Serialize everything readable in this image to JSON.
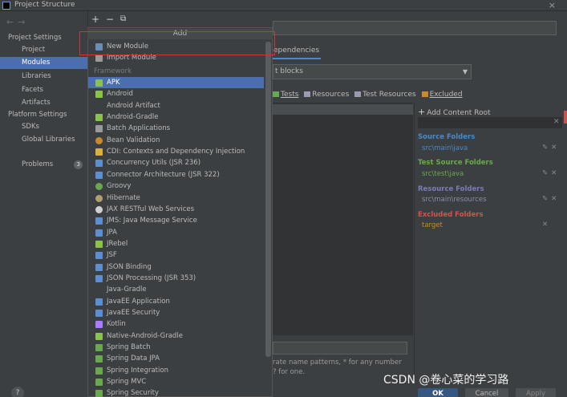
{
  "window": {
    "title": "Project Structure",
    "close": "×"
  },
  "toolbar": {
    "add": "+",
    "remove": "−",
    "copy": "⧉"
  },
  "nav": {
    "back": "←",
    "forward": "→"
  },
  "sidebar": {
    "group_project_settings": "Project Settings",
    "items_project": [
      {
        "label": "Project"
      },
      {
        "label": "Modules",
        "selected": true
      },
      {
        "label": "Libraries"
      },
      {
        "label": "Facets"
      },
      {
        "label": "Artifacts"
      }
    ],
    "group_platform_settings": "Platform Settings",
    "items_platform": [
      {
        "label": "SDKs"
      },
      {
        "label": "Global Libraries"
      }
    ],
    "problems": {
      "label": "Problems",
      "count": "3"
    },
    "help": "?"
  },
  "popup": {
    "header": "Add",
    "top_items": [
      {
        "label": "New Module",
        "icon": "module-icon",
        "color": "#6a8eb8"
      },
      {
        "label": "Import Module",
        "icon": "import-icon",
        "color": "#9a9a9a"
      }
    ],
    "section_label": "Framework",
    "framework_items": [
      {
        "label": "APK",
        "icon": "android-icon",
        "color": "#8bc34a",
        "selected": true
      },
      {
        "label": "Android",
        "icon": "android-icon",
        "color": "#8bc34a"
      },
      {
        "label": "Android Artifact",
        "icon": "",
        "color": ""
      },
      {
        "label": "Android-Gradle",
        "icon": "android-icon",
        "color": "#8bc34a"
      },
      {
        "label": "Batch Applications",
        "icon": "batch-icon",
        "color": "#9a9a9a"
      },
      {
        "label": "Bean Validation",
        "icon": "bean-icon",
        "color": "#c98a2b"
      },
      {
        "label": "CDI: Contexts and Dependency Injection",
        "icon": "cdi-icon",
        "color": "#d9b23a"
      },
      {
        "label": "Concurrency Utils (JSR 236)",
        "icon": "jee-icon",
        "color": "#5b8fd1"
      },
      {
        "label": "Connector Architecture (JSR 322)",
        "icon": "jee-icon",
        "color": "#5b8fd1"
      },
      {
        "label": "Groovy",
        "icon": "groovy-icon",
        "color": "#6aa84f"
      },
      {
        "label": "Hibernate",
        "icon": "hibernate-icon",
        "color": "#b0a070"
      },
      {
        "label": "JAX RESTful Web Services",
        "icon": "globe-icon",
        "color": "#cfcfcf"
      },
      {
        "label": "JMS: Java Message Service",
        "icon": "jee-icon",
        "color": "#5b8fd1"
      },
      {
        "label": "JPA",
        "icon": "jpa-icon",
        "color": "#5b8fd1"
      },
      {
        "label": "JRebel",
        "icon": "jrebel-icon",
        "color": "#8bc34a"
      },
      {
        "label": "JSF",
        "icon": "jee-icon",
        "color": "#5b8fd1"
      },
      {
        "label": "JSON Binding",
        "icon": "jee-icon",
        "color": "#5b8fd1"
      },
      {
        "label": "JSON Processing (JSR 353)",
        "icon": "jee-icon",
        "color": "#5b8fd1"
      },
      {
        "label": "Java-Gradle",
        "icon": "",
        "color": ""
      },
      {
        "label": "JavaEE Application",
        "icon": "jee-icon",
        "color": "#5b8fd1"
      },
      {
        "label": "JavaEE Security",
        "icon": "jee-icon",
        "color": "#5b8fd1"
      },
      {
        "label": "Kotlin",
        "icon": "kotlin-icon",
        "color": "#a97bff"
      },
      {
        "label": "Native-Android-Gradle",
        "icon": "android-icon",
        "color": "#8bc34a"
      },
      {
        "label": "Spring Batch",
        "icon": "spring-icon",
        "color": "#6aa84f"
      },
      {
        "label": "Spring Data JPA",
        "icon": "spring-icon",
        "color": "#6aa84f"
      },
      {
        "label": "Spring Integration",
        "icon": "spring-icon",
        "color": "#6aa84f"
      },
      {
        "label": "Spring MVC",
        "icon": "spring-icon",
        "color": "#6aa84f"
      },
      {
        "label": "Spring Security",
        "icon": "spring-icon",
        "color": "#6aa84f"
      }
    ]
  },
  "main": {
    "tab_dependencies": "ependencies",
    "sdk_dropdown": "t blocks",
    "mark_as": [
      {
        "label": "Tests",
        "color": "#6aa84f"
      },
      {
        "label": "Resources",
        "color": "#9a9ab0"
      },
      {
        "label": "Test Resources",
        "color": "#9a9ab0"
      },
      {
        "label": "Excluded",
        "color": "#c98a2b"
      }
    ],
    "add_content_root": "Add Content Root",
    "folders": [
      {
        "heading": "Source Folders",
        "heading_color": "#4a88c7",
        "path": "src\\main\\java",
        "path_color": "#4a88c7"
      },
      {
        "heading": "Test Source Folders",
        "heading_color": "#6aa84f",
        "path": "src\\test\\java",
        "path_color": "#6aa84f"
      },
      {
        "heading": "Resource Folders",
        "heading_color": "#7b7bb5",
        "path": "src\\main\\resources",
        "path_color": "#8a8aa8"
      },
      {
        "heading": "Excluded Folders",
        "heading_color": "#d25252",
        "path": "target",
        "path_color": "#c98a2b"
      }
    ],
    "hint_line1": "rate name patterns, * for any number",
    "hint_line2": "? for one."
  },
  "buttons": {
    "ok": "OK",
    "cancel": "Cancel",
    "apply": "Apply"
  },
  "watermark": "CSDN @卷心菜的学习路"
}
